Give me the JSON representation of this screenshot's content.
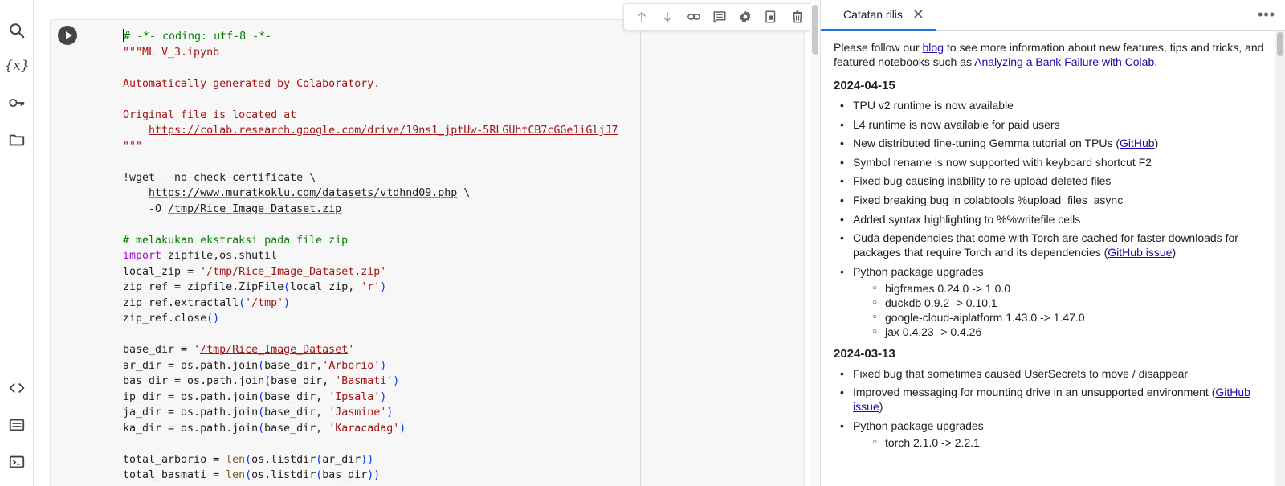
{
  "rail": {
    "items": [
      "search-icon",
      "variables-icon",
      "key-icon",
      "folder-icon",
      "code-snippets-icon",
      "command-palette-icon",
      "terminal-icon"
    ],
    "variables_glyph": "{x}"
  },
  "toolbar": {
    "buttons": [
      "move-up-icon",
      "move-down-icon",
      "link-icon",
      "comment-icon",
      "settings-icon",
      "mirror-cell-icon",
      "delete-icon",
      "more-vert-icon"
    ]
  },
  "code": {
    "lines": [
      [
        {
          "t": "# -*- coding: utf-8 -*-",
          "c": "com"
        }
      ],
      [
        {
          "t": "\"\"\"ML V_3.ipynb",
          "c": "str"
        }
      ],
      [
        {
          "t": "",
          "c": "def"
        }
      ],
      [
        {
          "t": "Automatically generated by Colaboratory.",
          "c": "str"
        }
      ],
      [
        {
          "t": "",
          "c": "def"
        }
      ],
      [
        {
          "t": "Original file is located at",
          "c": "str"
        }
      ],
      [
        {
          "t": "    ",
          "c": "str"
        },
        {
          "t": "https://colab.research.google.com/drive/19ns1_jptUw-5RLGUhtCB7cGGe1iGljJ7",
          "c": "str url"
        }
      ],
      [
        {
          "t": "\"\"\"",
          "c": "str"
        }
      ],
      [
        {
          "t": "",
          "c": "def"
        }
      ],
      [
        {
          "t": "!wget --no-check-certificate \\",
          "c": "def"
        }
      ],
      [
        {
          "t": "    ",
          "c": "def"
        },
        {
          "t": "https://www.muratkoklu.com/datasets/vtdhnd09.php",
          "c": "def under"
        },
        {
          "t": " \\",
          "c": "def"
        }
      ],
      [
        {
          "t": "    -O ",
          "c": "def"
        },
        {
          "t": "/tmp/Rice_Image_Dataset.zip",
          "c": "def under"
        }
      ],
      [
        {
          "t": "",
          "c": "def"
        }
      ],
      [
        {
          "t": "# melakukan ekstraksi pada file zip",
          "c": "com"
        }
      ],
      [
        {
          "t": "import",
          "c": "kw"
        },
        {
          "t": " zipfile,os,shutil",
          "c": "def"
        }
      ],
      [
        {
          "t": "local_zip = ",
          "c": "def"
        },
        {
          "t": "'",
          "c": "str"
        },
        {
          "t": "/tmp/Rice_Image_Dataset.zip",
          "c": "str url"
        },
        {
          "t": "'",
          "c": "str"
        }
      ],
      [
        {
          "t": "zip_ref = zipfile.ZipFile",
          "c": "def"
        },
        {
          "t": "(",
          "c": "p"
        },
        {
          "t": "local_zip, ",
          "c": "def"
        },
        {
          "t": "'r'",
          "c": "str"
        },
        {
          "t": ")",
          "c": "p"
        }
      ],
      [
        {
          "t": "zip_ref.extractall",
          "c": "def"
        },
        {
          "t": "(",
          "c": "p"
        },
        {
          "t": "'/tmp'",
          "c": "str"
        },
        {
          "t": ")",
          "c": "p"
        }
      ],
      [
        {
          "t": "zip_ref.close",
          "c": "def"
        },
        {
          "t": "()",
          "c": "p"
        }
      ],
      [
        {
          "t": "",
          "c": "def"
        }
      ],
      [
        {
          "t": "base_dir = ",
          "c": "def"
        },
        {
          "t": "'",
          "c": "str"
        },
        {
          "t": "/tmp/Rice_Image_Dataset",
          "c": "str url"
        },
        {
          "t": "'",
          "c": "str"
        }
      ],
      [
        {
          "t": "ar_dir = os.path.join",
          "c": "def"
        },
        {
          "t": "(",
          "c": "p"
        },
        {
          "t": "base_dir,",
          "c": "def"
        },
        {
          "t": "'Arborio'",
          "c": "str"
        },
        {
          "t": ")",
          "c": "p"
        }
      ],
      [
        {
          "t": "bas_dir = os.path.join",
          "c": "def"
        },
        {
          "t": "(",
          "c": "p"
        },
        {
          "t": "base_dir, ",
          "c": "def"
        },
        {
          "t": "'Basmati'",
          "c": "str"
        },
        {
          "t": ")",
          "c": "p"
        }
      ],
      [
        {
          "t": "ip_dir = os.path.join",
          "c": "def"
        },
        {
          "t": "(",
          "c": "p"
        },
        {
          "t": "base_dir, ",
          "c": "def"
        },
        {
          "t": "'Ipsala'",
          "c": "str"
        },
        {
          "t": ")",
          "c": "p"
        }
      ],
      [
        {
          "t": "ja_dir = os.path.join",
          "c": "def"
        },
        {
          "t": "(",
          "c": "p"
        },
        {
          "t": "base_dir, ",
          "c": "def"
        },
        {
          "t": "'Jasmine'",
          "c": "str"
        },
        {
          "t": ")",
          "c": "p"
        }
      ],
      [
        {
          "t": "ka_dir = os.path.join",
          "c": "def"
        },
        {
          "t": "(",
          "c": "p"
        },
        {
          "t": "base_dir, ",
          "c": "def"
        },
        {
          "t": "'Karacadag'",
          "c": "str"
        },
        {
          "t": ")",
          "c": "p"
        }
      ],
      [
        {
          "t": "",
          "c": "def"
        }
      ],
      [
        {
          "t": "total_arborio = ",
          "c": "def"
        },
        {
          "t": "len",
          "c": "fn"
        },
        {
          "t": "(",
          "c": "p"
        },
        {
          "t": "os.listdir",
          "c": "def"
        },
        {
          "t": "(",
          "c": "p"
        },
        {
          "t": "ar_dir",
          "c": "def"
        },
        {
          "t": "))",
          "c": "p"
        }
      ],
      [
        {
          "t": "total_basmati = ",
          "c": "def"
        },
        {
          "t": "len",
          "c": "fn"
        },
        {
          "t": "(",
          "c": "p"
        },
        {
          "t": "os.listdir",
          "c": "def"
        },
        {
          "t": "(",
          "c": "p"
        },
        {
          "t": "bas_dir",
          "c": "def"
        },
        {
          "t": "))",
          "c": "p"
        }
      ]
    ]
  },
  "panel": {
    "tab_label": "Catatan rilis",
    "close_glyph": "✕",
    "more_glyph": "•••",
    "intro": {
      "before_blog": "Please follow our ",
      "blog_link": "blog",
      "after_blog": " to see more information about new features, tips and tricks, and featured notebooks such as ",
      "featured_link": "Analyzing a Bank Failure with Colab",
      "end": "."
    },
    "releases": [
      {
        "date": "2024-04-15",
        "items": [
          {
            "text": "TPU v2 runtime is now available"
          },
          {
            "text": "L4 runtime is now available for paid users"
          },
          {
            "text": "New distributed fine-tuning Gemma tutorial on TPUs (",
            "link": "GitHub",
            "after": ")"
          },
          {
            "text": "Symbol rename is now supported with keyboard shortcut F2"
          },
          {
            "text": "Fixed bug causing inability to re-upload deleted files"
          },
          {
            "text": "Fixed breaking bug in colabtools %upload_files_async"
          },
          {
            "text": "Added syntax highlighting to %%writefile cells"
          },
          {
            "text": "Cuda dependencies that come with Torch are cached for faster downloads for packages that require Torch and its dependencies (",
            "link": "GitHub issue",
            "after": ")"
          },
          {
            "text": "Python package upgrades",
            "sub": [
              "bigframes 0.24.0 -> 1.0.0",
              "duckdb 0.9.2 -> 0.10.1",
              "google-cloud-aiplatform 1.43.0 -> 1.47.0",
              "jax 0.4.23 -> 0.4.26"
            ]
          }
        ]
      },
      {
        "date": "2024-03-13",
        "items": [
          {
            "text": "Fixed bug that sometimes caused UserSecrets to move / disappear"
          },
          {
            "text": "Improved messaging for mounting drive in an unsupported environment (",
            "link": "GitHub issue",
            "after": ")"
          },
          {
            "text": "Python package upgrades",
            "sub": [
              "torch 2.1.0 -> 2.2.1"
            ]
          }
        ]
      }
    ]
  },
  "colors": {
    "comment": "#0a7e07",
    "string": "#a31515",
    "keyword": "#af00db",
    "link": "#1a0dab",
    "tab_accent": "#1a73e8"
  }
}
